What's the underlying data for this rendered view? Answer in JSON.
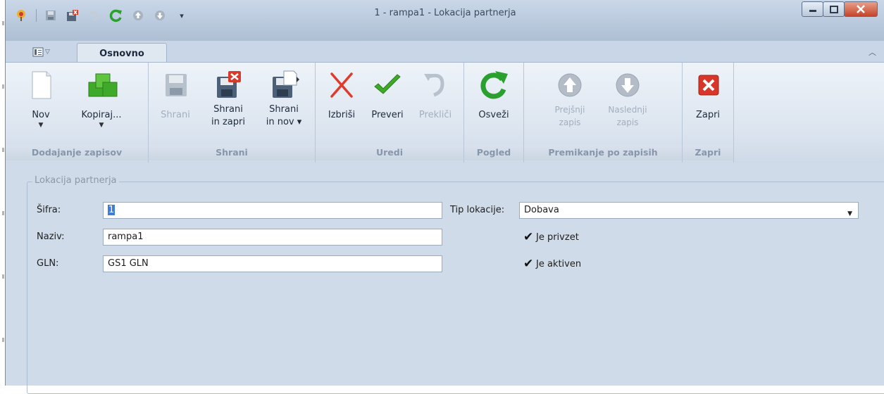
{
  "window": {
    "title": "1 - rampa1 - Lokacija partnerja"
  },
  "tabs": {
    "active": "Osnovno"
  },
  "ribbon": {
    "groups": [
      {
        "title": "Dodajanje zapisov",
        "buttons": [
          {
            "label": "Nov",
            "icon": "new-document-icon",
            "dropdown": "▼"
          },
          {
            "label": "Kopiraj...",
            "icon": "copy-cubes-icon",
            "dropdown": "▼"
          }
        ]
      },
      {
        "title": "Shrani",
        "buttons": [
          {
            "label": "Shrani",
            "icon": "save-icon",
            "disabled": true
          },
          {
            "label": "Shrani\nin zapri",
            "icon": "save-close-icon"
          },
          {
            "label": "Shrani\nin nov ▾",
            "icon": "save-new-icon"
          }
        ]
      },
      {
        "title": "Uredi",
        "buttons": [
          {
            "label": "Izbriši",
            "icon": "delete-icon"
          },
          {
            "label": "Preveri",
            "icon": "check-icon"
          },
          {
            "label": "Prekliči",
            "icon": "undo-icon",
            "disabled": true
          }
        ]
      },
      {
        "title": "Pogled",
        "buttons": [
          {
            "label": "Osveži",
            "icon": "refresh-icon"
          }
        ]
      },
      {
        "title": "Premikanje po zapisih",
        "buttons": [
          {
            "label": "Prejšnji\nzapis",
            "icon": "previous-record-icon",
            "disabled": true
          },
          {
            "label": "Naslednji\nzapis",
            "icon": "next-record-icon",
            "disabled": true
          }
        ]
      },
      {
        "title": "Zapri",
        "buttons": [
          {
            "label": "Zapri",
            "icon": "close-red-icon"
          }
        ]
      }
    ]
  },
  "form": {
    "legend": "Lokacija partnerja",
    "sifra": {
      "label": "Šifra:",
      "value": "1"
    },
    "naziv": {
      "label": "Naziv:",
      "value": "rampa1"
    },
    "gln": {
      "label": "GLN:",
      "value": "GS1 GLN"
    },
    "tip_lokacije": {
      "label": "Tip lokacije:",
      "value": "Dobava"
    },
    "je_privzet": {
      "label": "Je privzet",
      "checked": true
    },
    "je_aktiven": {
      "label": "Je aktiven",
      "checked": true
    }
  },
  "colors": {
    "accent_green": "#3faa2a",
    "delete_red": "#e03b2a",
    "close_red": "#d9362a",
    "selection_blue": "#3b7dd8"
  }
}
